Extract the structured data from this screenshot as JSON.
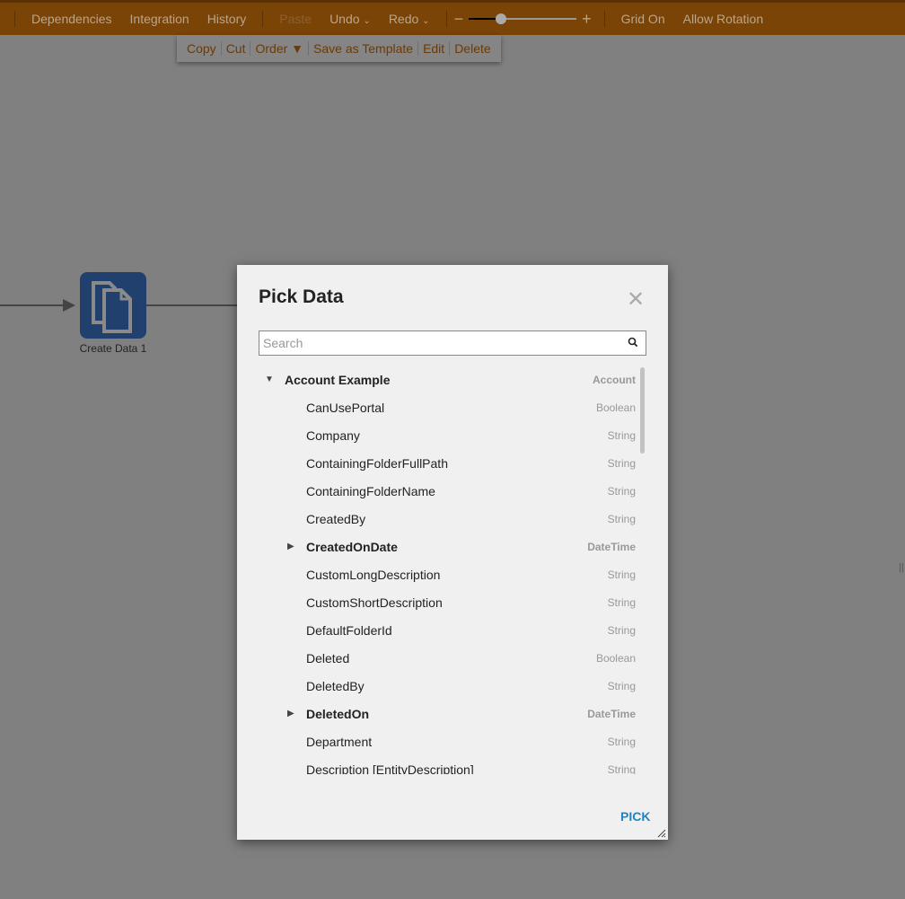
{
  "toolbar": {
    "items": [
      "Dependencies",
      "Integration",
      "History"
    ],
    "paste": "Paste",
    "undo": "Undo",
    "redo": "Redo",
    "zoom_minus": "−",
    "zoom_plus": "+",
    "grid": "Grid On",
    "rotation": "Allow Rotation",
    "zoom_level_percent": 30
  },
  "context_menu": [
    "Copy",
    "Cut",
    "Order ▼",
    "Save as Template",
    "Edit",
    "Delete"
  ],
  "canvas": {
    "node_label": "Create Data 1"
  },
  "dialog": {
    "title": "Pick Data",
    "search_placeholder": "Search",
    "pick_label": "PICK",
    "items": [
      {
        "name": "Account Example",
        "type": "Account",
        "bold": true,
        "expanded": true,
        "level": 0
      },
      {
        "name": "CanUsePortal",
        "type": "Boolean",
        "level": 1
      },
      {
        "name": "Company",
        "type": "String",
        "level": 1
      },
      {
        "name": "ContainingFolderFullPath",
        "type": "String",
        "level": 1
      },
      {
        "name": "ContainingFolderName",
        "type": "String",
        "level": 1
      },
      {
        "name": "CreatedBy",
        "type": "String",
        "level": 1
      },
      {
        "name": "CreatedOnDate",
        "type": "DateTime",
        "bold": true,
        "expandable": true,
        "level": 1
      },
      {
        "name": "CustomLongDescription",
        "type": "String",
        "level": 1
      },
      {
        "name": "CustomShortDescription",
        "type": "String",
        "level": 1
      },
      {
        "name": "DefaultFolderId",
        "type": "String",
        "level": 1
      },
      {
        "name": "Deleted",
        "type": "Boolean",
        "level": 1
      },
      {
        "name": "DeletedBy",
        "type": "String",
        "level": 1
      },
      {
        "name": "DeletedOn",
        "type": "DateTime",
        "bold": true,
        "expandable": true,
        "level": 1
      },
      {
        "name": "Department",
        "type": "String",
        "level": 1
      },
      {
        "name": "Description [EntityDescription]",
        "type": "String",
        "level": 1
      }
    ]
  }
}
